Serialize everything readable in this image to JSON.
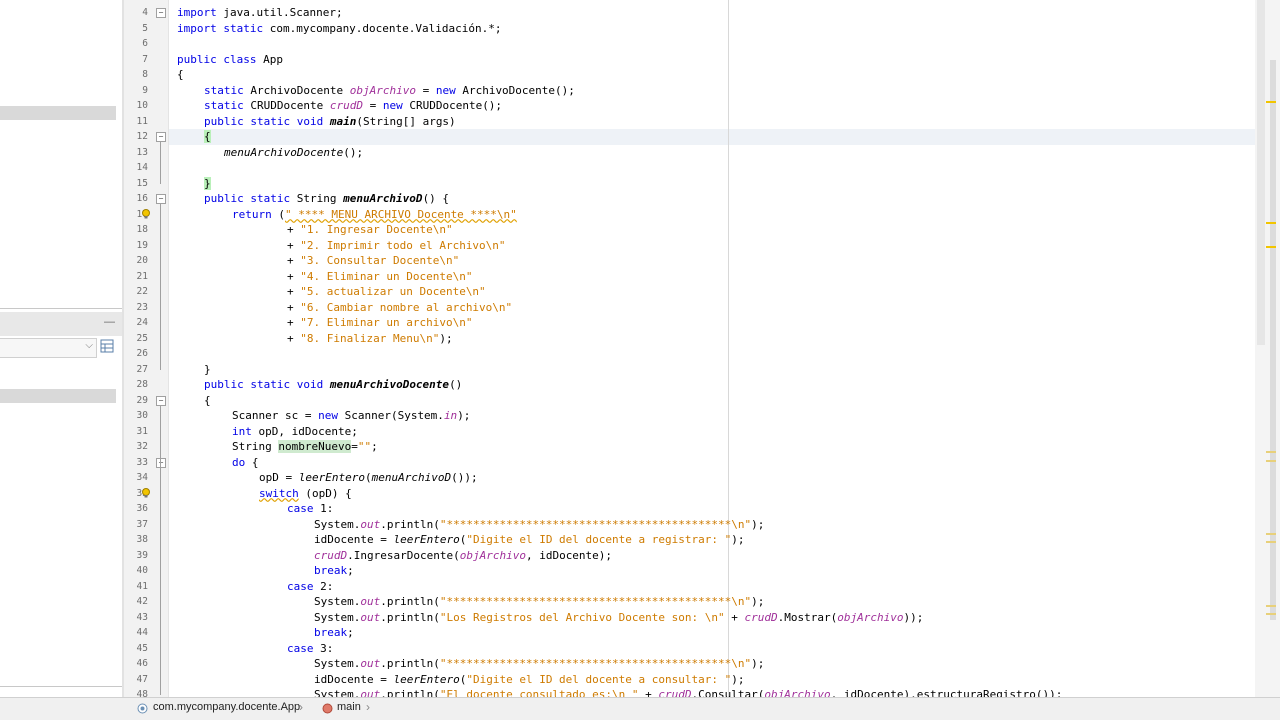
{
  "editor": {
    "line_numbers": [
      "4",
      "5",
      "6",
      "7",
      "8",
      "9",
      "10",
      "11",
      "12",
      "13",
      "14",
      "15",
      "16",
      "17",
      "18",
      "19",
      "20",
      "21",
      "22",
      "23",
      "24",
      "25",
      "26",
      "27",
      "28",
      "29",
      "30",
      "31",
      "32",
      "33",
      "34",
      "35",
      "36",
      "37",
      "38",
      "39",
      "40",
      "41",
      "42",
      "43",
      "44",
      "45",
      "46",
      "47",
      "48"
    ],
    "code": {
      "l4_kw": "import",
      "l4_rest": " java.util.Scanner;",
      "l5_kw": "import static",
      "l5_rest": " com.mycompany.docente.Validación.*;",
      "l7_kw": "public class",
      "l7_rest": " App",
      "l8": "{",
      "l9_kw": "static",
      "l9_a": " ArchivoDocente ",
      "l9_field": "objArchivo",
      "l9_b": " = ",
      "l9_new": "new",
      "l9_c": " ArchivoDocente();",
      "l10_kw": "static",
      "l10_a": " CRUDDocente ",
      "l10_field": "crudD",
      "l10_b": " = ",
      "l10_new": "new",
      "l10_c": " CRUDDocente();",
      "l11_kw": "public static void",
      "l11_m": "main",
      "l11_rest": "(String[] args)",
      "l12": "{",
      "l13": "menuArchivoDocente",
      "l13_rest": "();",
      "l15": "}",
      "l16_kw": "public static",
      "l16_a": " String ",
      "l16_m": "menuArchivoD",
      "l16_rest": "() {",
      "l17_kw": "return",
      "l17_a": " (",
      "l17_str": "\" **** MENU ARCHIVO Docente ****\\n\"",
      "l18_op": "+ ",
      "l18_str": "\"1. Ingresar Docente\\n\"",
      "l19_op": "+ ",
      "l19_str": "\"2. Imprimir todo el Archivo\\n\"",
      "l20_op": "+ ",
      "l20_str": "\"3. Consultar Docente\\n\"",
      "l21_op": "+ ",
      "l21_str": "\"4. Eliminar un Docente\\n\"",
      "l22_op": "+ ",
      "l22_str": "\"5. actualizar un Docente\\n\"",
      "l23_op": "+ ",
      "l23_str": "\"6. Cambiar nombre al archivo\\n\"",
      "l24_op": "+ ",
      "l24_str": "\"7. Eliminar un archivo\\n\"",
      "l25_op": "+ ",
      "l25_str": "\"8. Finalizar Menu\\n\"",
      "l25_end": ");",
      "l27": "}",
      "l28_kw": "public static void",
      "l28_m": "menuArchivoDocente",
      "l28_rest": "()",
      "l29": "{",
      "l30_a": "Scanner sc = ",
      "l30_new": "new",
      "l30_b": " Scanner(System.",
      "l30_in": "in",
      "l30_c": ");",
      "l31_kw": "int",
      "l31_rest": " opD, idDocente;",
      "l32_a": "String ",
      "l32_var": "nombreNuevo",
      "l32_b": "=",
      "l32_str": "\"\"",
      "l32_c": ";",
      "l33_kw": "do",
      "l33_rest": " {",
      "l34_a": "opD = ",
      "l34_m": "leerEntero",
      "l34_b": "(",
      "l34_m2": "menuArchivoD",
      "l34_c": "());",
      "l35_kw": "switch",
      "l35_rest": " (opD) {",
      "l36_kw": "case",
      "l36_rest": " 1:",
      "l37_a": "System.",
      "l37_out": "out",
      "l37_b": ".println(",
      "l37_str": "\"*******************************************\\n\"",
      "l37_c": ");",
      "l38_a": "idDocente = ",
      "l38_m": "leerEntero",
      "l38_b": "(",
      "l38_str": "\"Digite el ID del docente a registrar: \"",
      "l38_c": ");",
      "l39_field": "crudD",
      "l39_a": ".IngresarDocente(",
      "l39_field2": "objArchivo",
      "l39_b": ", idDocente);",
      "l40_kw": "break",
      "l40_rest": ";",
      "l41_kw": "case",
      "l41_rest": " 2:",
      "l42_a": "System.",
      "l42_out": "out",
      "l42_b": ".println(",
      "l42_str": "\"*******************************************\\n\"",
      "l42_c": ");",
      "l43_a": "System.",
      "l43_out": "out",
      "l43_b": ".println(",
      "l43_str": "\"Los Registros del Archivo Docente son: \\n\"",
      "l43_c": " + ",
      "l43_field": "crudD",
      "l43_d": ".Mostrar(",
      "l43_field2": "objArchivo",
      "l43_e": "));",
      "l44_kw": "break",
      "l44_rest": ";",
      "l45_kw": "case",
      "l45_rest": " 3:",
      "l46_a": "System.",
      "l46_out": "out",
      "l46_b": ".println(",
      "l46_str": "\"*******************************************\\n\"",
      "l46_c": ");",
      "l47_a": "idDocente = ",
      "l47_m": "leerEntero",
      "l47_b": "(",
      "l47_str": "\"Digite el ID del docente a consultar: \"",
      "l47_c": ");",
      "l48_a": "System.",
      "l48_out": "out",
      "l48_b": ".println(",
      "l48_str": "\"El docente consultado es:\\n \"",
      "l48_c": " + ",
      "l48_field": "crudD",
      "l48_d": ".Consultar(",
      "l48_field2": "objArchivo",
      "l48_e": ", idDocente).estructuraRegistro());"
    }
  },
  "breadcrumb": {
    "class_label": "com.mycompany.docente.App",
    "method_label": "main",
    "separator": "›"
  },
  "colors": {
    "keyword": "#0000e6",
    "string": "#ce7b00",
    "field": "#009900",
    "static_field": "#a0309a",
    "hint": "#f2c500"
  },
  "icons": [
    "class-icon",
    "method-icon",
    "hint-bulb-icon",
    "fold-icon",
    "table-view-icon",
    "dropdown-chevron-icon",
    "minimize-icon"
  ]
}
